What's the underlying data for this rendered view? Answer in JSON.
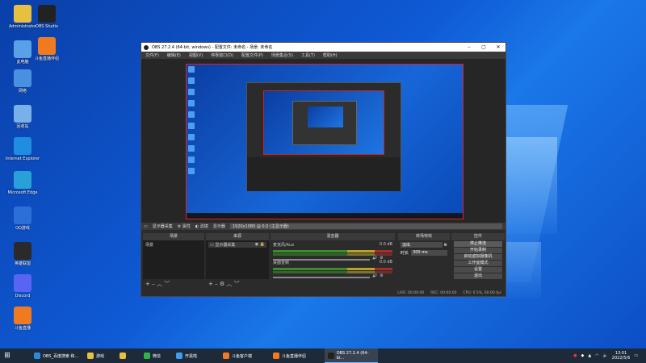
{
  "desktop": {
    "icons": [
      {
        "label": "Administrator",
        "color": "#e8c040"
      },
      {
        "label": "OBS Studio",
        "color": "#222"
      },
      {
        "label": "此电脑",
        "color": "#5aa0e6"
      },
      {
        "label": "斗鱼直播伴侣",
        "color": "#f07a20"
      },
      {
        "label": "网络",
        "color": "#4a90e0"
      },
      {
        "label": "回收站",
        "color": "#7ab0e8"
      },
      {
        "label": "Internet Explorer",
        "color": "#1f8de0"
      },
      {
        "label": "Microsoft Edge",
        "color": "#2aa0d8"
      },
      {
        "label": "QQ游戏",
        "color": "#2d6fd8"
      },
      {
        "label": "英雄联盟",
        "color": "#2a2a2a"
      },
      {
        "label": "Discord",
        "color": "#5865f2"
      },
      {
        "label": "斗鱼直播",
        "color": "#f07a20"
      }
    ]
  },
  "obs": {
    "title": "OBS 27.2.4 (64-bit, windows) - 配置文件: 未命名 - 场景: 未命名",
    "menu": [
      "文件(F)",
      "编辑(E)",
      "视图(V)",
      "停靠窗口(D)",
      "配置文件(P)",
      "场景集合(S)",
      "工具(T)",
      "帮助(H)"
    ],
    "source_bar": {
      "name": "显示器采集",
      "properties": "属性",
      "filters": "滤镜",
      "display_label": "显示器",
      "display_value": "1920x1080 @ 0,0 (主显示器)"
    },
    "docks": {
      "scenes": {
        "header": "场景",
        "items": [
          "场景"
        ]
      },
      "sources": {
        "header": "来源",
        "items": [
          "显示器采集"
        ]
      },
      "mixer": {
        "header": "混音器",
        "tracks": [
          {
            "name": "麦克风/Aux",
            "db": "0.0 dB"
          },
          {
            "name": "桌面音频",
            "db": "0.0 dB"
          }
        ]
      },
      "transitions": {
        "header": "转场特效",
        "type": "淡出",
        "duration_label": "时长",
        "duration": "300 ms"
      },
      "controls": {
        "header": "控件",
        "buttons": [
          "停止推流",
          "开始录制",
          "启动虚拟摄像机",
          "工作室模式",
          "设置",
          "退出"
        ]
      }
    },
    "status": {
      "live": "LIVE: 00:00:00",
      "rec": "REC: 00:00:00",
      "cpu": "CPU: 0.5%, 60.00 fps"
    }
  },
  "taskbar": {
    "items": [
      {
        "label": "OBS_百度搜索 和...",
        "color": "#2a8ae0"
      },
      {
        "label": "游戏",
        "color": "#e8c040"
      },
      {
        "label": "",
        "color": "#e8c040"
      },
      {
        "label": "微信",
        "color": "#2fb24a"
      },
      {
        "label": "开黑啦",
        "color": "#3a9ee8"
      },
      {
        "label": "斗鱼客户端",
        "color": "#f07a20"
      },
      {
        "label": "斗鱼直播伴侣",
        "color": "#f07a20"
      },
      {
        "label": "OBS 27.2.4 (64-bi...",
        "color": "#222"
      }
    ],
    "time": "13:01",
    "date": "2022/5/6"
  }
}
